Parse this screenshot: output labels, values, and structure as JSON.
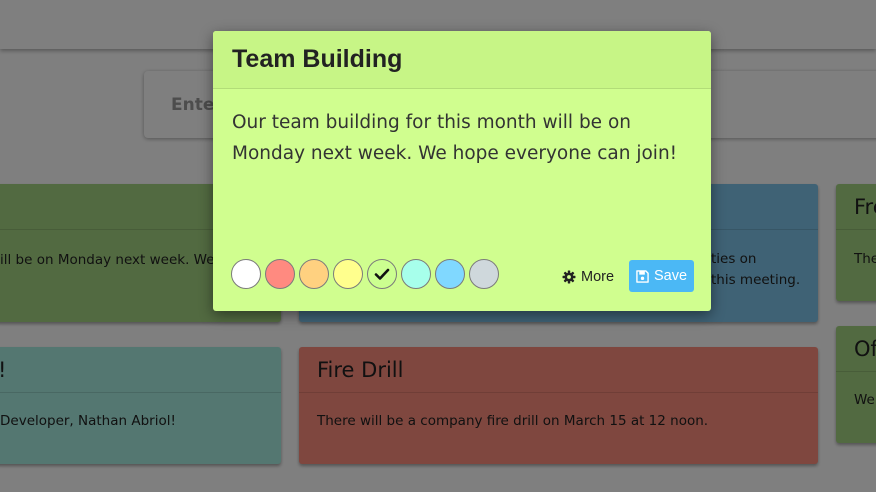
{
  "composer": {
    "placeholder": "Enter"
  },
  "notes": [
    {
      "title": "",
      "body": "ill be on Monday next week. We ho",
      "color": "#a5d583"
    },
    {
      "title": "",
      "body_lines": [
        "ties on",
        "this meeting."
      ],
      "color": "#7fc5ea"
    },
    {
      "title": "Fre",
      "body": "The",
      "color": "#a5d583"
    },
    {
      "title": "!",
      "body": "Developer, Nathan Abriol!",
      "color": "#a8eee3"
    },
    {
      "title": "Fire Drill",
      "body": "There will be a company fire drill on March 15 at 12 noon.",
      "color": "#ff8e7e"
    },
    {
      "title": "Of",
      "body": "We'",
      "color": "#a5d583"
    }
  ],
  "modal": {
    "title": "Team Building",
    "content": "Our team building for this month will be on Monday next week. We hope everyone can join!",
    "background": "#d0fe8f",
    "swatches": [
      {
        "name": "white",
        "color": "#ffffff",
        "selected": false
      },
      {
        "name": "red",
        "color": "#ff8a80",
        "selected": false
      },
      {
        "name": "orange",
        "color": "#ffd180",
        "selected": false
      },
      {
        "name": "yellow",
        "color": "#ffff8d",
        "selected": false
      },
      {
        "name": "green",
        "color": "#ccff90",
        "selected": true
      },
      {
        "name": "teal",
        "color": "#a7ffeb",
        "selected": false
      },
      {
        "name": "blue",
        "color": "#80d8ff",
        "selected": false
      },
      {
        "name": "gray",
        "color": "#cfd8dc",
        "selected": false
      }
    ],
    "more_label": "More",
    "more_icon": "gear-icon",
    "save_label": "Save",
    "save_icon": "floppy-icon",
    "save_color": "#4bb8f5"
  }
}
